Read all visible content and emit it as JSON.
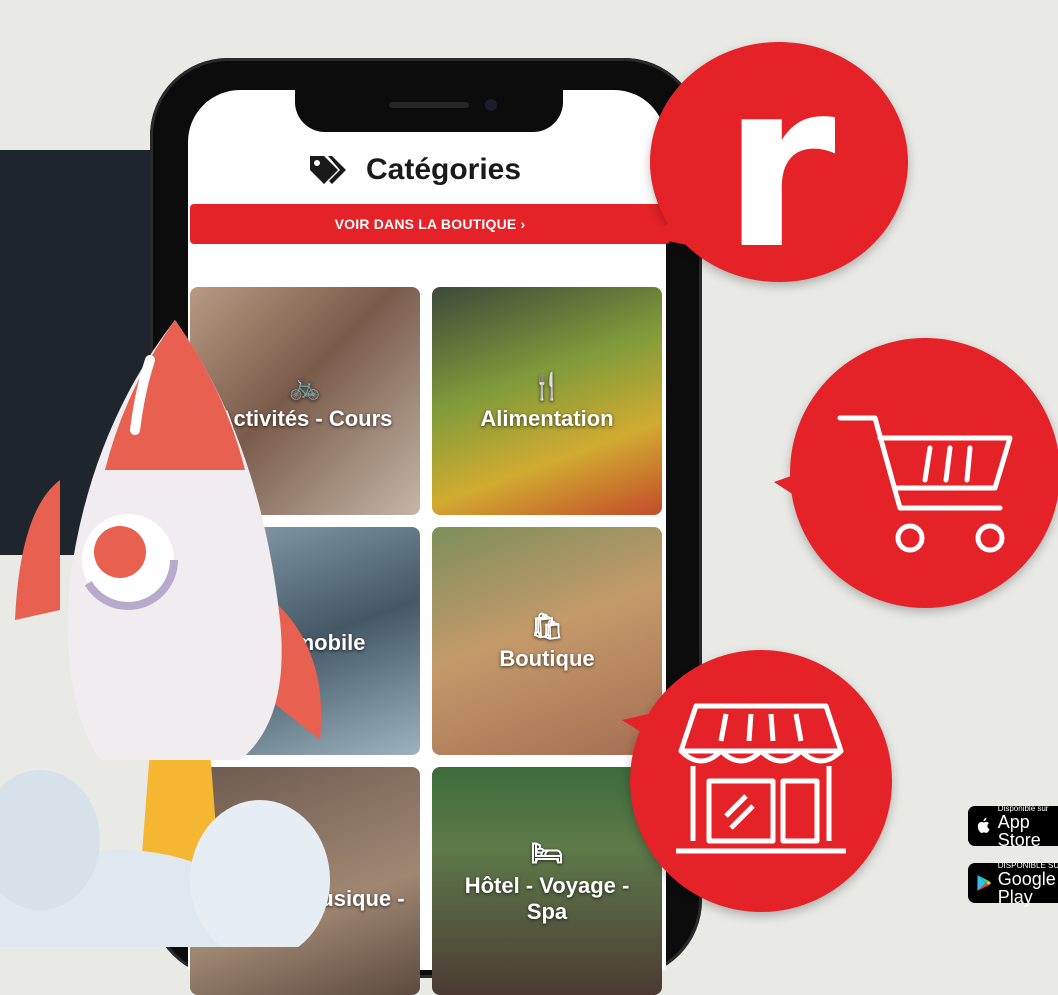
{
  "header": {
    "title": "Catégories",
    "tag_icon": "tag-icon"
  },
  "shop_button": {
    "label": "VOIR DANS LA BOUTIQUE ›"
  },
  "categories": [
    {
      "label": "Activités - Cours",
      "icon": "bicycle-icon",
      "glyph": "🚲"
    },
    {
      "label": "Alimentation",
      "icon": "utensils-icon",
      "glyph": "🍴"
    },
    {
      "label": "Automobile",
      "icon": "car-icon",
      "glyph": ""
    },
    {
      "label": "Boutique",
      "icon": "shopping-bag-icon",
      "glyph": "🛍"
    },
    {
      "label": "Culture - Musique -",
      "icon": "star-icon",
      "glyph": "★"
    },
    {
      "label": "Hôtel - Voyage - Spa",
      "icon": "bed-icon",
      "glyph": "🛏"
    }
  ],
  "badges": [
    {
      "name": "logo-badge",
      "letter": "r"
    },
    {
      "name": "cart-badge",
      "icon": "shopping-cart-icon"
    },
    {
      "name": "store-badge",
      "icon": "storefront-icon"
    }
  ],
  "app_store": {
    "small": "Disponible sur",
    "big": "App Store"
  },
  "google_play": {
    "small": "DISPONIBLE SUR",
    "big": "Google Play"
  },
  "colors": {
    "brand_red": "#e52228",
    "dark_panel": "#1e252c",
    "background": "#e9e9e6"
  }
}
